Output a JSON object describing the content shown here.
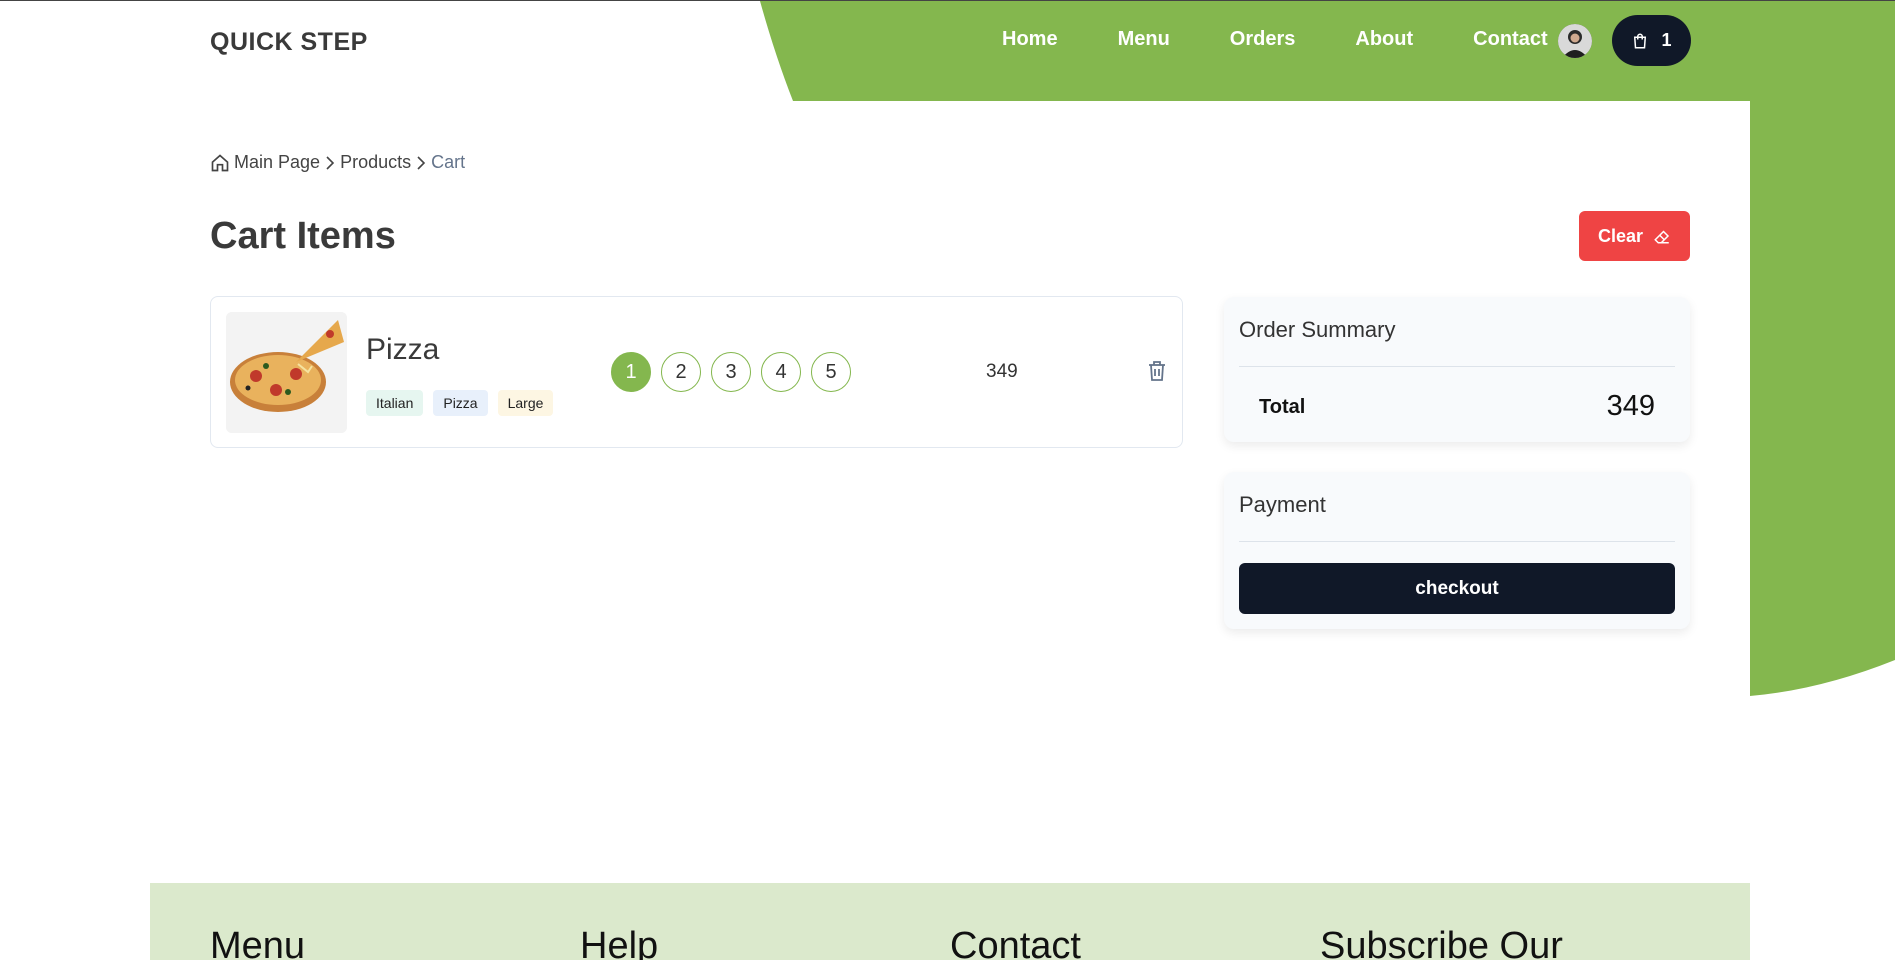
{
  "header": {
    "logo": "QUICK STEP",
    "nav": [
      "Home",
      "Menu",
      "Orders",
      "About",
      "Contact"
    ],
    "cart_count": "1"
  },
  "breadcrumb": {
    "home_label": "Main Page",
    "products_label": "Products",
    "current_label": "Cart"
  },
  "page": {
    "title": "Cart Items",
    "clear_label": "Clear"
  },
  "cart": {
    "items": [
      {
        "name": "Pizza",
        "tags": [
          "Italian",
          "Pizza",
          "Large"
        ],
        "quantity_options": [
          "1",
          "2",
          "3",
          "4",
          "5"
        ],
        "selected_quantity": "1",
        "price": "349"
      }
    ]
  },
  "summary": {
    "title": "Order Summary",
    "total_label": "Total",
    "total_value": "349"
  },
  "payment": {
    "title": "Payment",
    "checkout_label": "checkout"
  },
  "footer": {
    "columns": [
      "Menu",
      "Help",
      "Contact",
      "Subscribe Our"
    ]
  },
  "colors": {
    "brand_green": "#84b74e",
    "dark": "#101828",
    "danger": "#ef4444",
    "footer_bg": "#dbe9cc"
  }
}
